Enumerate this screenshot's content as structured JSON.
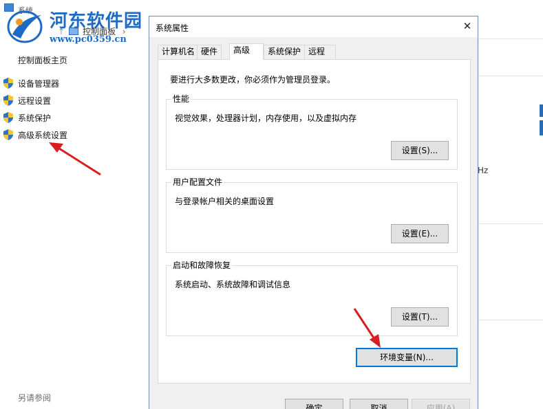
{
  "background": {
    "window_title": "系统",
    "nav": {
      "arrow": "↑",
      "breadcrumb": "控制面板",
      "breadcrumb_chevron": "›"
    },
    "sidebar": {
      "home": "控制面板主页",
      "items": [
        {
          "label": "设备管理器",
          "icon": "uac-shield-icon"
        },
        {
          "label": "远程设置",
          "icon": "uac-shield-icon"
        },
        {
          "label": "系统保护",
          "icon": "uac-shield-icon"
        },
        {
          "label": "高级系统设置",
          "icon": "uac-shield-icon"
        }
      ],
      "see_also": "另请参阅"
    },
    "right_fragment": "Hz"
  },
  "watermark": {
    "brand": "河东软件园",
    "url": "www.pc0359.cn"
  },
  "dialog": {
    "title": "系统属性",
    "close_glyph": "✕",
    "tabs": [
      {
        "label": "计算机名",
        "active": false
      },
      {
        "label": "硬件",
        "active": false
      },
      {
        "label": "高级",
        "active": true
      },
      {
        "label": "系统保护",
        "active": false
      },
      {
        "label": "远程",
        "active": false
      }
    ],
    "notice": "要进行大多数更改，你必须作为管理员登录。",
    "groups": {
      "performance": {
        "label": "性能",
        "description": "视觉效果，处理器计划，内存使用，以及虚拟内存",
        "button": "设置(S)..."
      },
      "user_profiles": {
        "label": "用户配置文件",
        "description": "与登录帐户相关的桌面设置",
        "button": "设置(E)..."
      },
      "startup_recovery": {
        "label": "启动和故障恢复",
        "description": "系统启动、系统故障和调试信息",
        "button": "设置(T)..."
      }
    },
    "env_button": "环境变量(N)...",
    "footer": {
      "ok": "确定",
      "cancel": "取消",
      "apply": "应用(A)"
    }
  },
  "annotation_color": "#d81e1e"
}
